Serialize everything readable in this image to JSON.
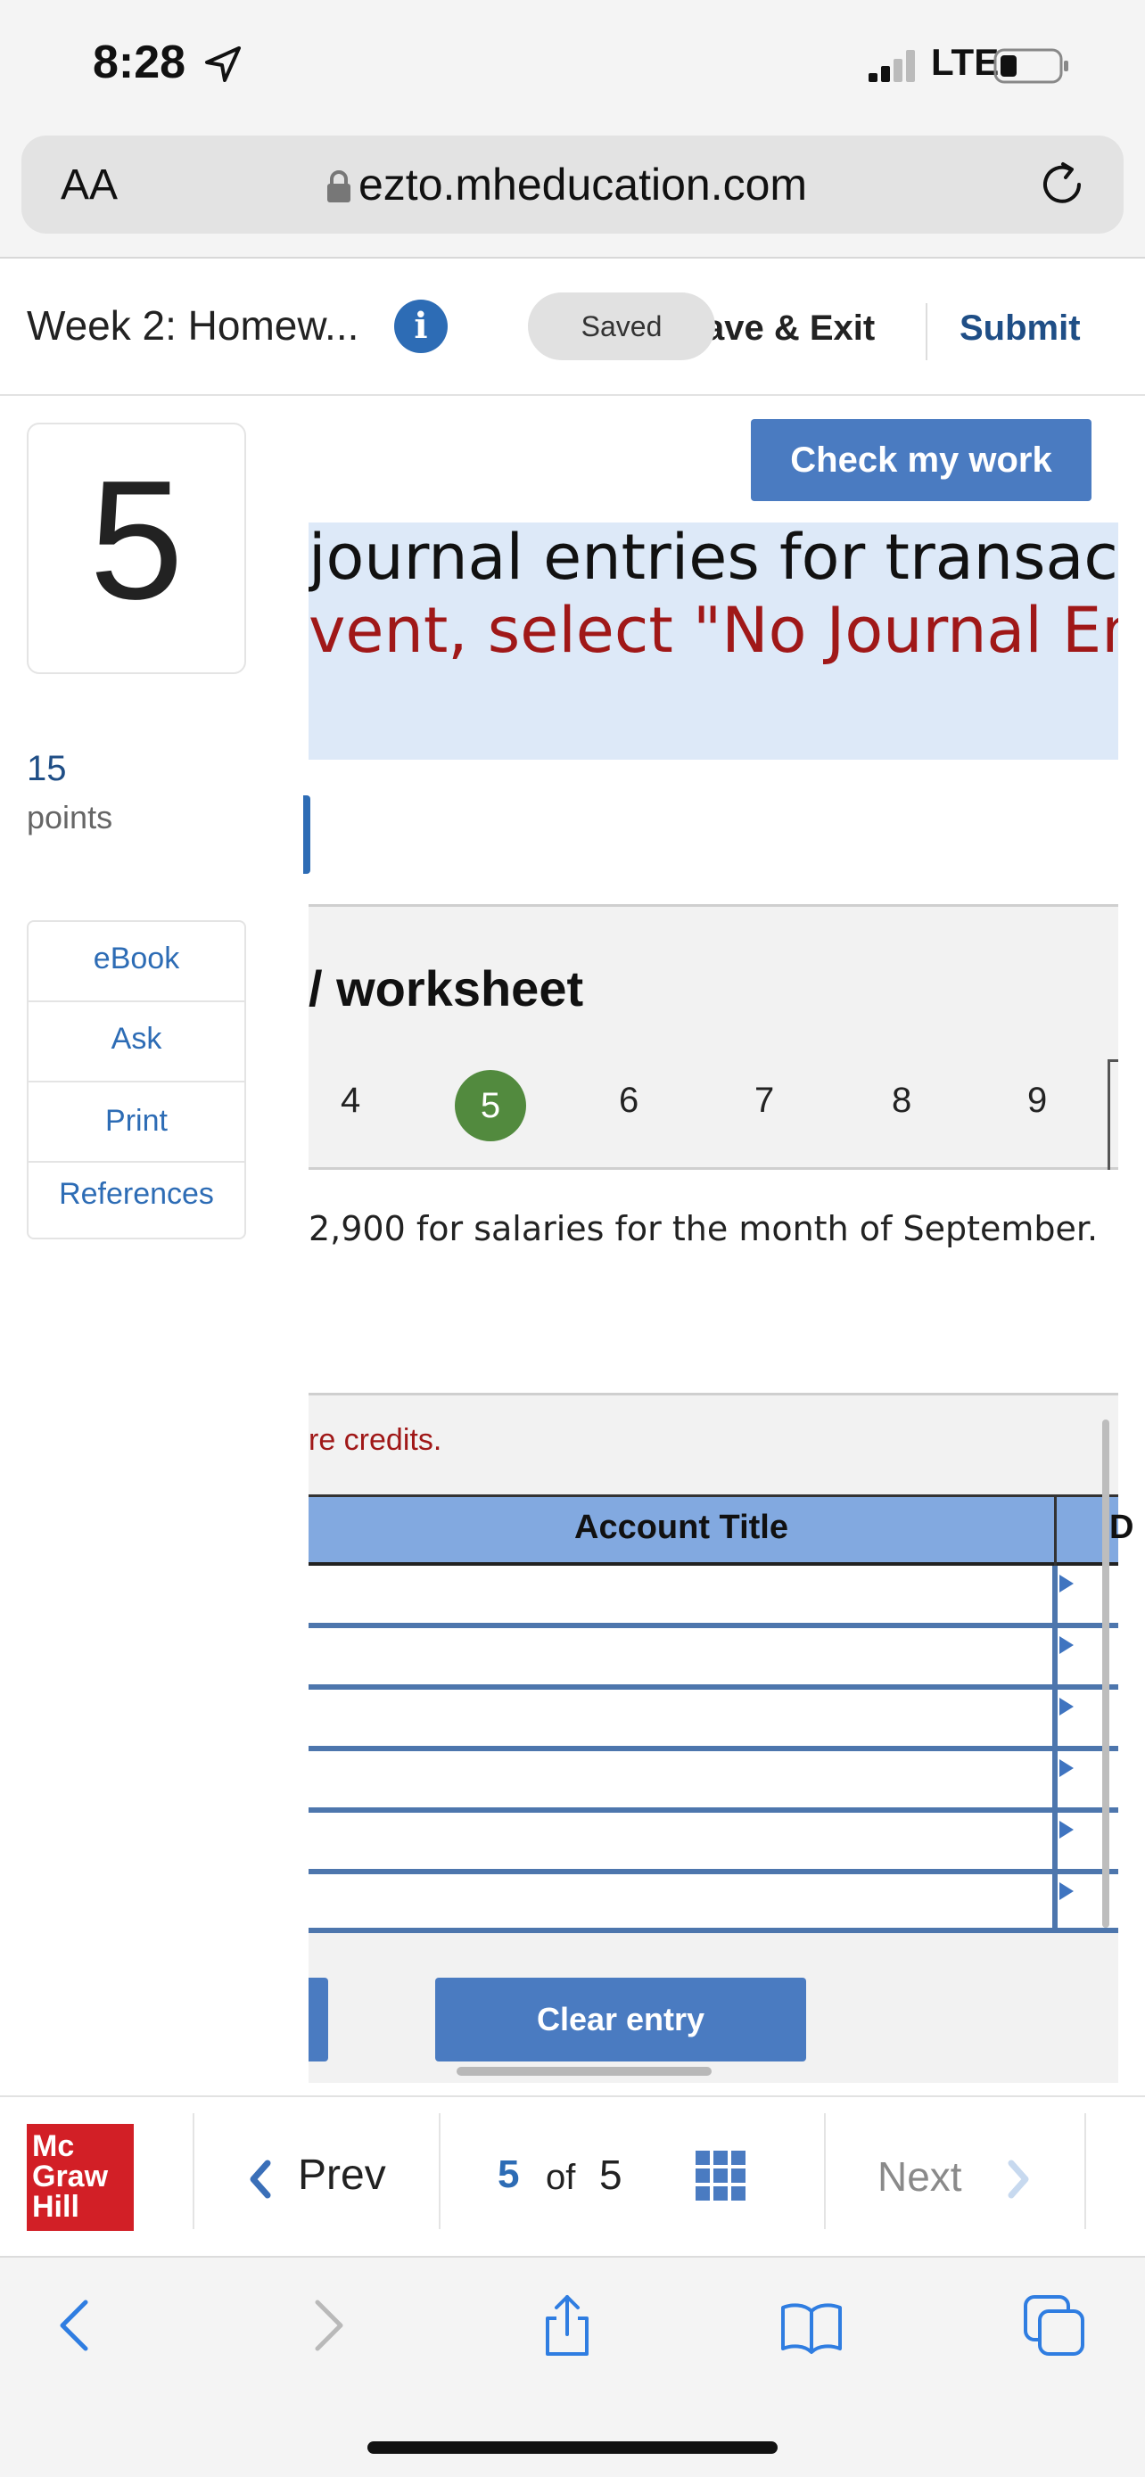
{
  "status_bar": {
    "time": "8:28",
    "network": "LTE",
    "icons": [
      "location-arrow-icon",
      "signal-bars-icon",
      "battery-icon"
    ]
  },
  "browser": {
    "text_size_label": "AA",
    "url": "ezto.mheducation.com",
    "icons": [
      "lock-icon",
      "reload-icon"
    ]
  },
  "header": {
    "assignment_title": "Week 2: Homew...",
    "info_glyph": "i",
    "saved_badge": "Saved",
    "save_exit_label": "ave & Exit",
    "submit_label": "Submit"
  },
  "sidebar": {
    "question_number": "5",
    "points_value": "15",
    "points_label": "points",
    "tools": [
      "eBook",
      "Ask",
      "Print",
      "References"
    ]
  },
  "question": {
    "check_button": "Check my work",
    "instruction_line1": "journal entries for transactio",
    "instruction_line2": "vent, select \"No Journal Ent",
    "worksheet_title": "/ worksheet",
    "tabs": [
      "4",
      "5",
      "6",
      "7",
      "8",
      "9"
    ],
    "active_tab": "5",
    "transaction_text": "2,900 for salaries for the month of September.",
    "credit_note": "re credits.",
    "table_header_account": "Account Title",
    "table_header_debit": "D",
    "row_count": 6,
    "clear_button": "Clear entry"
  },
  "bottom_nav": {
    "logo_lines": [
      "Mc",
      "Graw",
      "Hill"
    ],
    "prev_label": "Prev",
    "page_current": "5",
    "page_of": "of",
    "page_total": "5",
    "next_label": "Next"
  },
  "colors": {
    "primary_blue": "#4a7bc1",
    "link_blue": "#2d6cb5",
    "instruction_bg": "#dde9f8",
    "error_red": "#a01818",
    "active_tab_green": "#528a3e",
    "logo_red": "#d21f26"
  }
}
